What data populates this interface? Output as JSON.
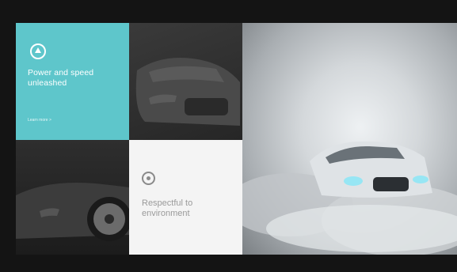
{
  "tiles": {
    "power": {
      "title": "Power and speed unleashed",
      "link": "Learn more  >",
      "color": "#5ec6cb"
    },
    "environment": {
      "title": "Respectful to environment"
    }
  },
  "icons": {
    "power_icon": "flame-icon",
    "environment_icon": "leaf-icon"
  }
}
